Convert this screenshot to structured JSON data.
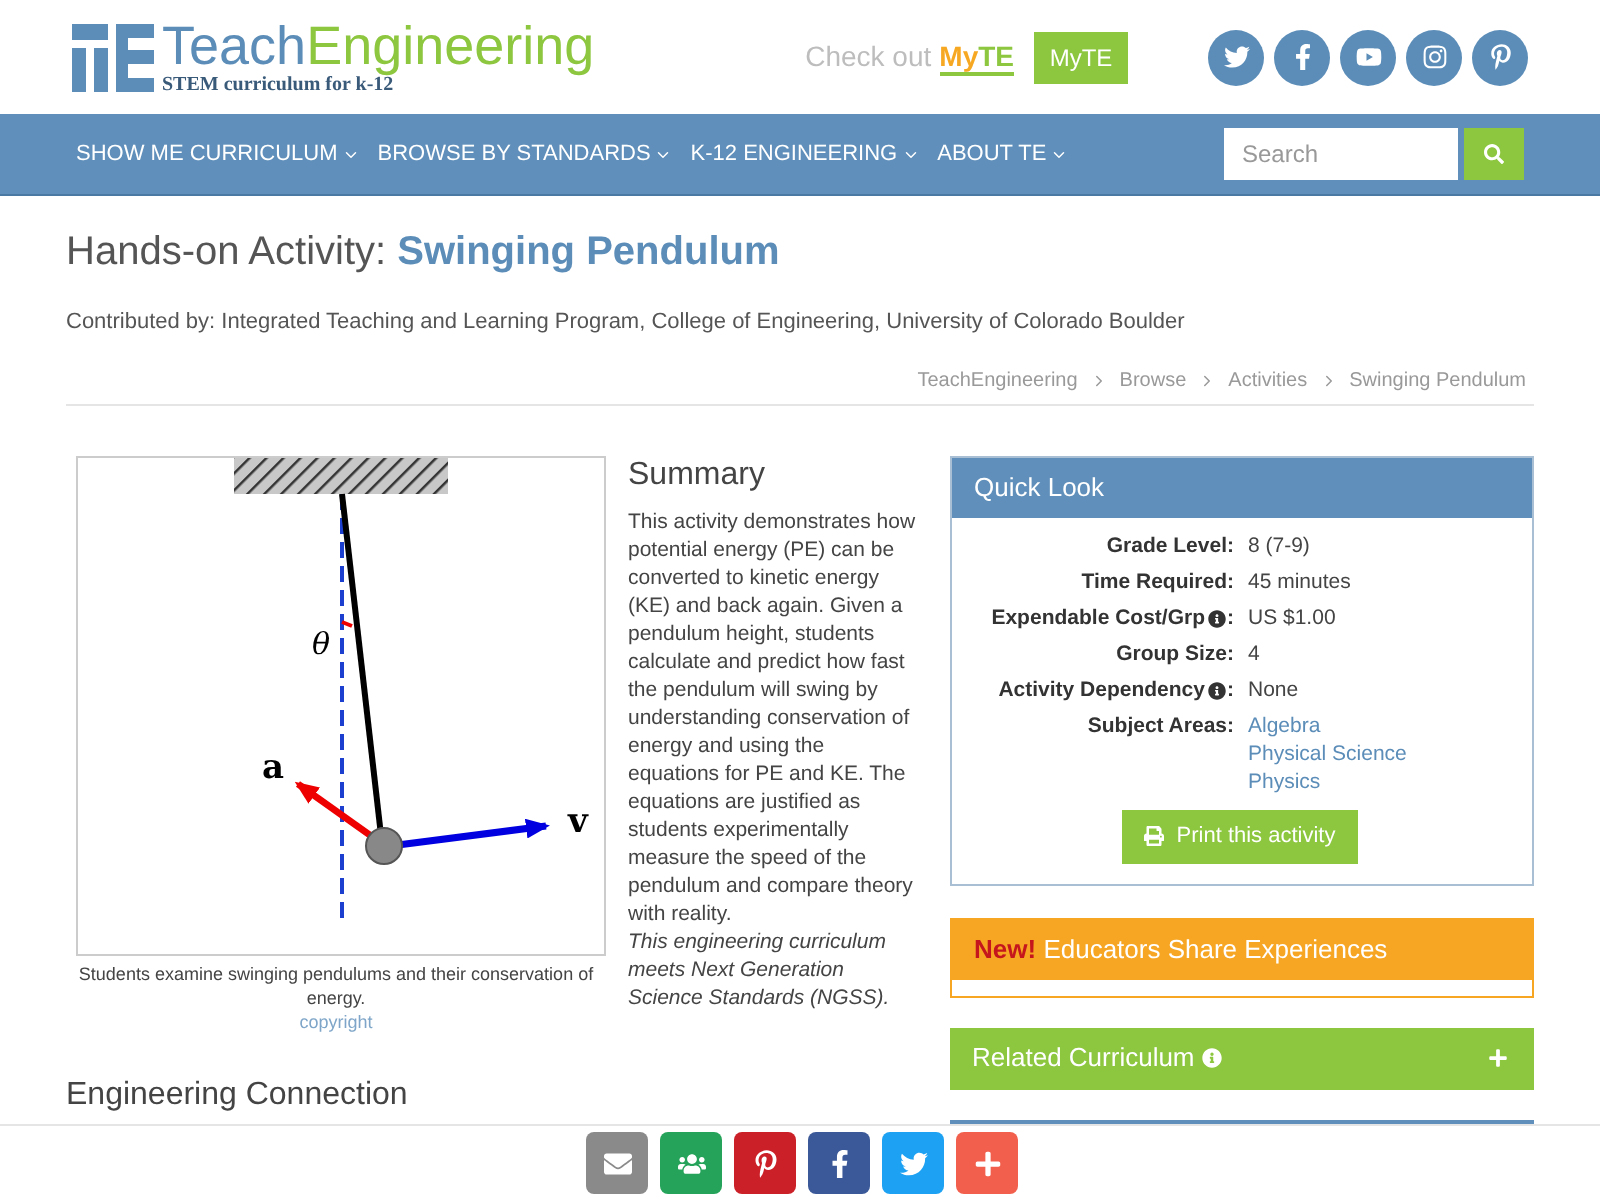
{
  "header": {
    "logo": {
      "first": "Teach",
      "second": "Engineering",
      "tagline": "STEM curriculum for k-12"
    },
    "promo": {
      "text": "Check out",
      "brand_first": "My",
      "brand_second": "TE"
    },
    "myte_button": "MyTE",
    "social": [
      {
        "kind": "twitter"
      },
      {
        "kind": "facebook"
      },
      {
        "kind": "youtube"
      },
      {
        "kind": "instagram"
      },
      {
        "kind": "pinterest"
      }
    ]
  },
  "nav": {
    "items": [
      "SHOW ME CURRICULUM",
      "BROWSE BY STANDARDS",
      "K-12 ENGINEERING",
      "ABOUT TE"
    ],
    "search": {
      "placeholder": "Search"
    }
  },
  "page": {
    "title_prefix": "Hands-on Activity:",
    "title": "Swinging Pendulum",
    "contributed": "Contributed by: Integrated Teaching and Learning Program, College of Engineering, University of Colorado Boulder",
    "breadcrumb": [
      "TeachEngineering",
      "Browse",
      "Activities",
      "Swinging Pendulum"
    ]
  },
  "figure": {
    "labels": {
      "acceleration": "a",
      "velocity": "v",
      "angle": "θ"
    },
    "caption": "Students examine swinging pendulums and their conservation of energy.",
    "copyright": "copyright"
  },
  "summary": {
    "heading": "Summary",
    "text": "This activity demonstrates how potential energy (PE) can be converted to kinetic energy (KE) and back again. Given a pendulum height, students calculate and predict how fast the pendulum will swing by understanding conservation of energy and using the equations for PE and KE. The equations are justified as students experimentally measure the speed of the pendulum and compare theory with reality.",
    "note": "This engineering curriculum meets Next Generation Science Standards (NGSS)."
  },
  "engineering_connection": {
    "heading": "Engineering Connection"
  },
  "quick_look": {
    "title": "Quick Look",
    "rows": [
      {
        "label": "Grade Level:",
        "info": false,
        "values": [
          "8 (7-9)"
        ],
        "kind": "text"
      },
      {
        "label": "Time Required:",
        "info": false,
        "values": [
          "45 minutes"
        ],
        "kind": "text"
      },
      {
        "label": "Expendable Cost/Grp",
        "info": true,
        "suffix": ":",
        "values": [
          "US $1.00"
        ],
        "kind": "text"
      },
      {
        "label": "Group Size:",
        "info": false,
        "values": [
          "4"
        ],
        "kind": "text"
      },
      {
        "label": "Activity Dependency",
        "info": true,
        "suffix": ":",
        "values": [
          "None"
        ],
        "kind": "text"
      },
      {
        "label": "Subject Areas:",
        "info": false,
        "values": [
          "Algebra",
          "Physical Science",
          "Physics"
        ],
        "kind": "links"
      }
    ],
    "print_button": "Print this activity"
  },
  "educators": {
    "badge": "New!",
    "title": "Educators Share Experiences"
  },
  "related": {
    "title": "Related Curriculum",
    "expanded": false
  },
  "share": [
    {
      "kind": "email"
    },
    {
      "kind": "classroom"
    },
    {
      "kind": "pinterest"
    },
    {
      "kind": "facebook"
    },
    {
      "kind": "twitter"
    },
    {
      "kind": "more"
    }
  ]
}
